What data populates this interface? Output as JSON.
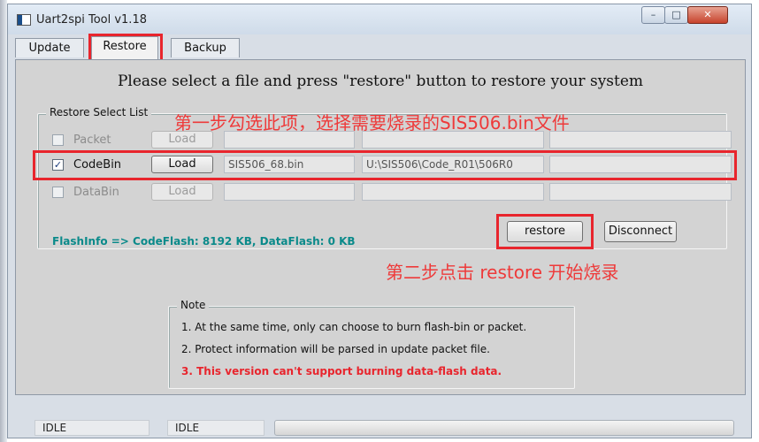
{
  "window": {
    "title": "Uart2spi Tool v1.18",
    "controls": {
      "minimize": "–",
      "maximize": "□",
      "close": "✕"
    }
  },
  "tabs": [
    {
      "label": "Update"
    },
    {
      "label": "Restore"
    },
    {
      "label": "Backup"
    }
  ],
  "restore_panel": {
    "heading": "Please select a file and press \"restore\" button to restore your system",
    "group_label": "Restore Select List",
    "annotation_step1": "第一步勾选此项，选择需要烧录的SIS506.bin文件",
    "rows": [
      {
        "label": "Packet",
        "checked": false,
        "enabled": false,
        "load": "Load",
        "file": "",
        "path": "",
        "extra": ""
      },
      {
        "label": "CodeBin",
        "checked": true,
        "enabled": true,
        "load": "Load",
        "file": "SIS506_68.bin",
        "path": "U:\\SIS506\\Code_R01\\506R0",
        "extra": ""
      },
      {
        "label": "DataBin",
        "checked": false,
        "enabled": false,
        "load": "Load",
        "file": "",
        "path": "",
        "extra": ""
      }
    ],
    "check_mark": "✓",
    "flash_info": "FlashInfo => CodeFlash: 8192 KB, DataFlash: 0 KB",
    "restore_button": "restore",
    "disconnect_button": "Disconnect",
    "annotation_step2": "第二步点击 restore 开始烧录"
  },
  "note": {
    "label": "Note",
    "lines": [
      "1. At the same time, only can choose to burn flash-bin or packet.",
      "2. Protect information will be parsed in update packet file.",
      "3. This version can't support burning data-flash data."
    ]
  },
  "status_bar": {
    "left": "IDLE",
    "middle": "IDLE"
  },
  "colors": {
    "annotation_red": "#e8252d",
    "flash_info": "#0a8a8a"
  }
}
